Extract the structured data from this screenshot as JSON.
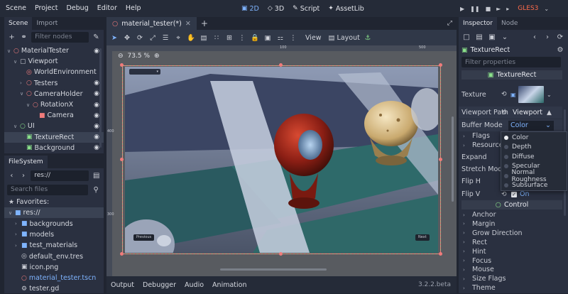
{
  "menu": [
    "Scene",
    "Project",
    "Debug",
    "Editor",
    "Help"
  ],
  "workspaces": [
    {
      "label": "2D",
      "icon": "▣",
      "active": true
    },
    {
      "label": "3D",
      "icon": "◇",
      "active": false
    },
    {
      "label": "Script",
      "icon": "✎",
      "active": false
    },
    {
      "label": "AssetLib",
      "icon": "✦",
      "active": false
    }
  ],
  "renderer": "GLES3",
  "scene_dock": {
    "tabs": [
      "Scene",
      "Import"
    ],
    "filter_placeholder": "Filter nodes",
    "tree": [
      {
        "label": "MaterialTester",
        "depth": 0,
        "icon_color": "#f07b7b",
        "icon": "○",
        "arrow": "∨",
        "eye": true
      },
      {
        "label": "Viewport",
        "depth": 1,
        "icon_color": "#c9ccd4",
        "icon": "▢",
        "arrow": "∨",
        "eye": false
      },
      {
        "label": "WorldEnvironment",
        "depth": 2,
        "icon_color": "#f07b7b",
        "icon": "◎",
        "arrow": "",
        "eye": false
      },
      {
        "label": "Testers",
        "depth": 2,
        "icon_color": "#f07b7b",
        "icon": "○",
        "arrow": "›",
        "eye": true
      },
      {
        "label": "CameraHolder",
        "depth": 2,
        "icon_color": "#f07b7b",
        "icon": "○",
        "arrow": "∨",
        "eye": true
      },
      {
        "label": "RotationX",
        "depth": 3,
        "icon_color": "#f07b7b",
        "icon": "○",
        "arrow": "∨",
        "eye": true
      },
      {
        "label": "Camera",
        "depth": 4,
        "icon_color": "#f07b7b",
        "icon": "■",
        "arrow": "",
        "eye": true
      },
      {
        "label": "UI",
        "depth": 1,
        "icon_color": "#8be28b",
        "icon": "○",
        "arrow": "∨",
        "eye": true
      },
      {
        "label": "TextureRect",
        "depth": 2,
        "icon_color": "#8be28b",
        "icon": "▣",
        "arrow": "",
        "eye": true,
        "selected": true
      },
      {
        "label": "Background",
        "depth": 2,
        "icon_color": "#8be28b",
        "icon": "▣",
        "arrow": "",
        "eye": true
      }
    ]
  },
  "filesystem": {
    "title": "FileSystem",
    "path": "res://",
    "search_placeholder": "Search files",
    "items": [
      {
        "label": "Favorites:",
        "icon": "★",
        "depth": 0,
        "type": "fav"
      },
      {
        "label": "res://",
        "icon": "■",
        "depth": 0,
        "type": "root",
        "selected": true
      },
      {
        "label": "backgrounds",
        "icon": "■",
        "depth": 1,
        "type": "folder"
      },
      {
        "label": "models",
        "icon": "■",
        "depth": 1,
        "type": "folder"
      },
      {
        "label": "test_materials",
        "icon": "■",
        "depth": 1,
        "type": "folder"
      },
      {
        "label": "default_env.tres",
        "icon": "◎",
        "depth": 1,
        "type": "file"
      },
      {
        "label": "icon.png",
        "icon": "▣",
        "depth": 1,
        "type": "file"
      },
      {
        "label": "material_tester.tscn",
        "icon": "○",
        "depth": 1,
        "type": "scene"
      },
      {
        "label": "tester.gd",
        "icon": "⚙",
        "depth": 1,
        "type": "file"
      }
    ]
  },
  "viewport": {
    "scene_tab": "material_tester(*)",
    "zoom": "73.5 %",
    "view_label": "View",
    "layout_label": "Layout",
    "ruler_marks": [
      "100",
      "500",
      "400",
      "300"
    ],
    "previous": "Previous",
    "next": "Next",
    "inner_field": "▾"
  },
  "bottom_tabs": [
    "Output",
    "Debugger",
    "Audio",
    "Animation"
  ],
  "version": "3.2.2.beta",
  "inspector": {
    "tabs": [
      "Inspector",
      "Node"
    ],
    "node_name": "TextureRect",
    "filter_placeholder": "Filter properties",
    "header": "TextureRect",
    "texture_label": "Texture",
    "viewport_path_label": "Viewport Path",
    "viewport_path_value": "Viewport",
    "buffer_mode_label": "Buffer Mode",
    "buffer_mode_value": "Color",
    "flags_label": "Flags",
    "resource_label": "Resource",
    "expand_label": "Expand",
    "stretch_label": "Stretch Mode",
    "flip_h_label": "Flip H",
    "flip_v_label": "Flip V",
    "flip_v_value": "On",
    "control_header": "Control",
    "groups": [
      "Anchor",
      "Margin",
      "Grow Direction",
      "Rect",
      "Hint",
      "Focus",
      "Mouse",
      "Size Flags",
      "Theme"
    ]
  },
  "buffer_dropdown": {
    "options": [
      "Color",
      "Depth",
      "Diffuse",
      "Specular",
      "Normal Roughness",
      "Subsurface"
    ],
    "selected": 0
  },
  "colors": {
    "accent": "#7fb4ff",
    "node3d": "#f07b7b",
    "control": "#8be28b",
    "renderer": "#ff6b4a"
  }
}
